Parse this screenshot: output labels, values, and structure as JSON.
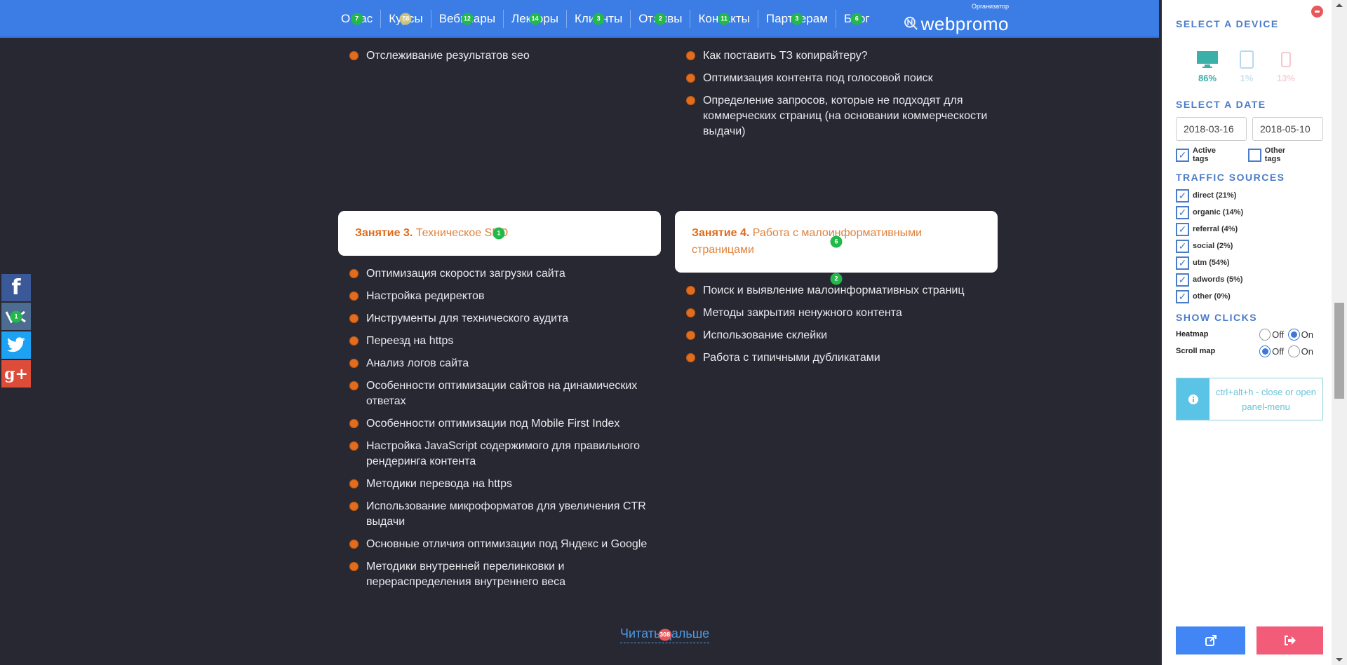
{
  "header": {
    "nav": [
      {
        "label": "О нас",
        "badge": "7",
        "badge_style": "green"
      },
      {
        "label": "Курсы",
        "badge": "58",
        "badge_style": "yellow"
      },
      {
        "label": "Вебинары",
        "badge": "12",
        "badge_style": "green"
      },
      {
        "label": "Лекторы",
        "badge": "14",
        "badge_style": "green"
      },
      {
        "label": "Клиенты",
        "badge": "3",
        "badge_style": "green"
      },
      {
        "label": "Отзывы",
        "badge": "2",
        "badge_style": "green"
      },
      {
        "label": "Контакты",
        "badge": "11",
        "badge_style": "green"
      },
      {
        "label": "Партнерам",
        "badge": "3",
        "badge_style": "green"
      },
      {
        "label": "Блог",
        "badge": "6",
        "badge_style": "green"
      }
    ],
    "logo": {
      "text": "webpromo",
      "caption": "Организатор"
    }
  },
  "main": {
    "left_top_list": [
      "Отслеживание результатов seo"
    ],
    "right_top_list": [
      "Как поставить ТЗ копирайтеру?",
      "Оптимизация контента под голосовой поиск",
      "Определение запросов, которые не подходят для коммерческих страниц (на основании коммерческости выдачи)"
    ],
    "lesson3": {
      "prefix": "Занятие 3.",
      "title": "Техническое SEO",
      "badge": "1",
      "items": [
        "Оптимизация скорости загрузки сайта",
        "Настройка редиректов",
        "Инструменты для технического аудита",
        "Переезд на https",
        "Анализ логов сайта",
        "Особенности оптимизации сайтов на динамических ответах",
        "Особенности оптимизации под Mobile First Index",
        "Настройка JavaScript содержимого для правильного рендеринга контента",
        "Методики перевода на https",
        "Использование микроформатов для увеличения CTR выдачи",
        "Основные отличия оптимизации под Яндекс и Google",
        "Методики внутренней перелинковки и перераспределения внутреннего веса"
      ]
    },
    "lesson4": {
      "prefix": "Занятие 4.",
      "title": "Работа с малоинформативными страницами",
      "badge": "6",
      "list_badge": "2",
      "items": [
        "Поиск и выявление малоинформативных страниц",
        "Методы закрытия ненужного контента",
        "Использование склейки",
        "Работа с типичными дубликатами"
      ]
    },
    "read_more": {
      "label": "Читать дальше",
      "badge": "308"
    }
  },
  "social": {
    "items": [
      {
        "name": "facebook",
        "glyph": "f"
      },
      {
        "name": "vk",
        "glyph": "vk",
        "badge": "1"
      },
      {
        "name": "twitter",
        "glyph": "twitter-bird"
      },
      {
        "name": "google-plus",
        "glyph": "g+"
      }
    ]
  },
  "panel": {
    "device_title": "SELECT A DEVICE",
    "devices": [
      {
        "name": "desktop",
        "pct": "86%",
        "color": "#3bb0a8"
      },
      {
        "name": "tablet",
        "pct": "1%",
        "color": "#b9d9ee"
      },
      {
        "name": "mobile",
        "pct": "13%",
        "color": "#f4c8d0"
      }
    ],
    "date_title": "SELECT A DATE",
    "date_from": "2018-03-16",
    "date_to": "2018-05-10",
    "active_tags": {
      "label": "Active tags",
      "checked": true
    },
    "other_tags": {
      "label": "Other tags",
      "checked": false
    },
    "traffic_title": "TRAFFIC SOURCES",
    "sources": [
      {
        "label": "direct (21%)",
        "checked": true
      },
      {
        "label": "organic (14%)",
        "checked": true
      },
      {
        "label": "referral (4%)",
        "checked": true
      },
      {
        "label": "social (2%)",
        "checked": true
      },
      {
        "label": "utm (54%)",
        "checked": true
      },
      {
        "label": "adwords (5%)",
        "checked": true
      },
      {
        "label": "other (0%)",
        "checked": true
      }
    ],
    "clicks_title": "SHOW CLICKS",
    "heatmap": {
      "label": "Heatmap",
      "off": "Off",
      "on": "On",
      "value": "On"
    },
    "scrollmap": {
      "label": "Scroll map",
      "off": "Off",
      "on": "On",
      "value": "Off"
    },
    "info_text": "ctrl+alt+h - close or open panel-menu",
    "check_glyph": "✓"
  }
}
